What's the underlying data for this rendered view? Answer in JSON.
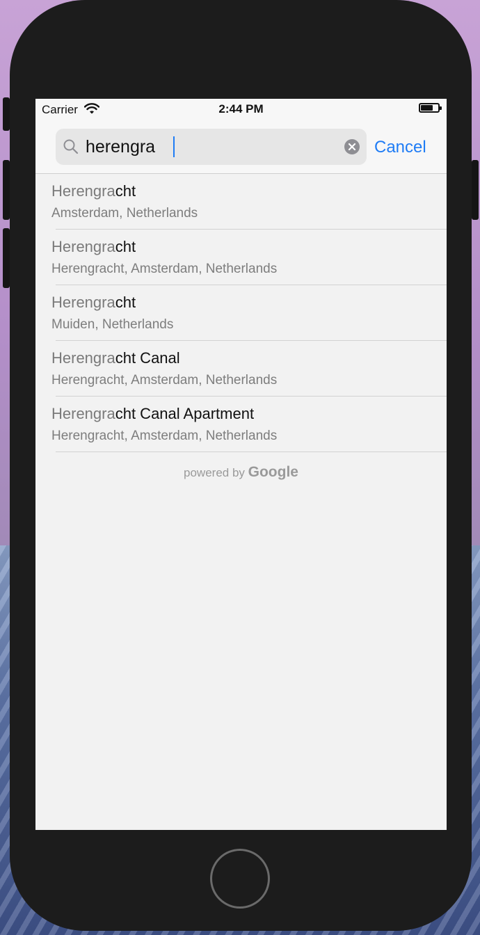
{
  "status_bar": {
    "carrier": "Carrier",
    "time": "2:44 PM"
  },
  "search": {
    "query": "herengra",
    "cancel_label": "Cancel"
  },
  "colors": {
    "accent": "#1f7cf5",
    "match_text": "#7a7a7a",
    "secondary_text": "#7d7d7d"
  },
  "results": [
    {
      "match": "Herengra",
      "rest": "cht",
      "subtitle": "Amsterdam, Netherlands"
    },
    {
      "match": "Herengra",
      "rest": "cht",
      "subtitle": "Herengracht, Amsterdam, Netherlands"
    },
    {
      "match": "Herengra",
      "rest": "cht",
      "subtitle": "Muiden, Netherlands"
    },
    {
      "match": "Herengra",
      "rest": "cht Canal",
      "subtitle": "Herengracht, Amsterdam, Netherlands"
    },
    {
      "match": "Herengra",
      "rest": "cht Canal Apartment",
      "subtitle": "Herengracht, Amsterdam, Netherlands"
    }
  ],
  "attribution": {
    "prefix": "powered by ",
    "brand": "Google"
  }
}
